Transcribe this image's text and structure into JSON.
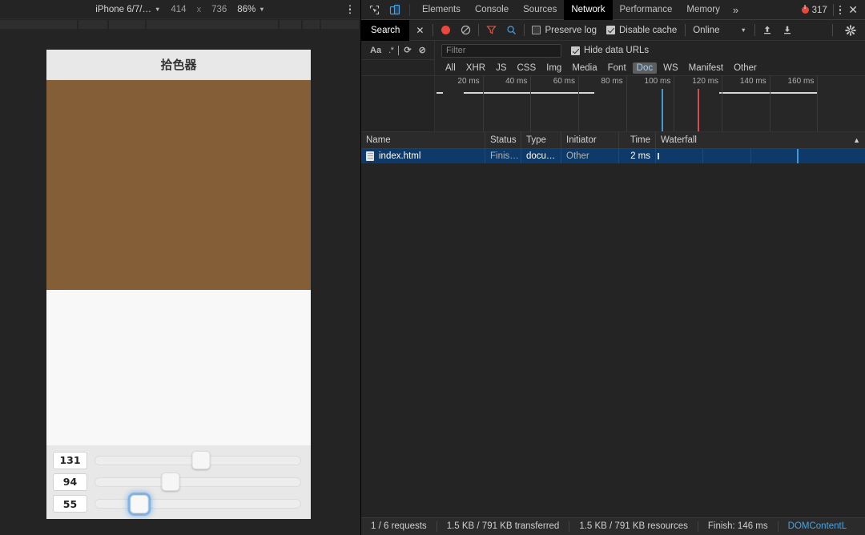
{
  "device_toolbar": {
    "device": "iPhone 6/7/…",
    "width": "414",
    "times": "x",
    "height": "736",
    "zoom": "86%",
    "menu_icon": "kebab-menu-icon"
  },
  "phone": {
    "title": "拾色器",
    "swatch_color": "#835e37",
    "sliders": [
      {
        "label": "131",
        "value": 131,
        "max": 255,
        "focused": false
      },
      {
        "label": "94",
        "value": 94,
        "max": 255,
        "focused": false
      },
      {
        "label": "55",
        "value": 55,
        "max": 255,
        "focused": true
      }
    ]
  },
  "devtools": {
    "tabs": [
      {
        "label": "Elements",
        "active": false
      },
      {
        "label": "Console",
        "active": false
      },
      {
        "label": "Sources",
        "active": false
      },
      {
        "label": "Network",
        "active": true
      },
      {
        "label": "Performance",
        "active": false
      },
      {
        "label": "Memory",
        "active": false
      }
    ],
    "more_tabs": "»",
    "error_count": "317",
    "kebab": "more-options-icon",
    "close": "✕",
    "inspect_icon": "inspect-element-icon",
    "device_icon": "toggle-device-toolbar-icon"
  },
  "network_toolbar": {
    "search_tab": "Search",
    "search_close": "✕",
    "record_icon": "record-icon",
    "clear_icon": "clear-icon",
    "filter_icon": "filter-icon",
    "search_icon": "search-icon",
    "preserve_log": {
      "label": "Preserve log",
      "checked": false
    },
    "disable_cache": {
      "label": "Disable cache",
      "checked": true
    },
    "throttling": "Online",
    "import_icon": "import-har-icon",
    "export_icon": "export-har-icon",
    "settings_icon": "gear-icon"
  },
  "search_panel": {
    "match_case": "Aa",
    "regex": ".*",
    "refresh_icon": "refresh-icon",
    "clear_icon": "clear-search-icon"
  },
  "filter_row": {
    "placeholder": "Filter",
    "value": "",
    "hide_data_urls": {
      "label": "Hide data URLs",
      "checked": true
    }
  },
  "type_filters": [
    {
      "label": "All",
      "active": false
    },
    {
      "label": "XHR",
      "active": false
    },
    {
      "label": "JS",
      "active": false
    },
    {
      "label": "CSS",
      "active": false
    },
    {
      "label": "Img",
      "active": false
    },
    {
      "label": "Media",
      "active": false
    },
    {
      "label": "Font",
      "active": false
    },
    {
      "label": "Doc",
      "active": true
    },
    {
      "label": "WS",
      "active": false
    },
    {
      "label": "Manifest",
      "active": false
    },
    {
      "label": "Other",
      "active": false
    }
  ],
  "timeline": {
    "ticks": [
      "20 ms",
      "40 ms",
      "60 ms",
      "80 ms",
      "100 ms",
      "120 ms",
      "140 ms",
      "160 ms"
    ],
    "dcl_color": "#3f9ad6",
    "load_color": "#d84b4b"
  },
  "table": {
    "columns": [
      "Name",
      "Status",
      "Type",
      "Initiator",
      "Time",
      "Waterfall"
    ],
    "sort_arrow": "▲",
    "rows": [
      {
        "name": "index.html",
        "status": "Finis…",
        "type": "docu…",
        "initiator": "Other",
        "time": "2 ms",
        "icon": "document-icon"
      }
    ]
  },
  "status_bar": {
    "requests": "1 / 6 requests",
    "transferred": "1.5 KB / 791 KB transferred",
    "resources": "1.5 KB / 791 KB resources",
    "finish": "Finish: 146 ms",
    "dcl": "DOMContentL"
  }
}
